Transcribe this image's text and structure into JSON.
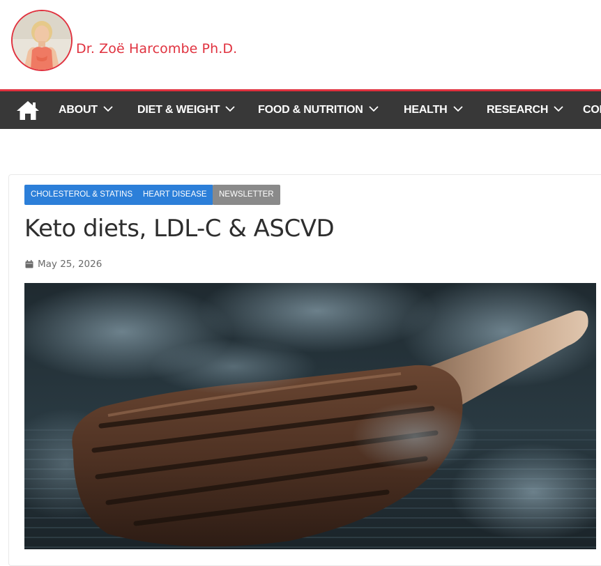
{
  "site": {
    "title": "Dr. Zoë Harcombe Ph.D."
  },
  "nav": {
    "home_icon": "home-icon",
    "items": [
      {
        "label": "ABOUT"
      },
      {
        "label": "DIET & WEIGHT"
      },
      {
        "label": "FOOD & NUTRITION"
      },
      {
        "label": "HEALTH"
      },
      {
        "label": "RESEARCH"
      },
      {
        "label": "CON"
      }
    ]
  },
  "article": {
    "categories": [
      {
        "label": "CHOLESTEROL & STATINS",
        "color": "#2c7fd9"
      },
      {
        "label": "HEART DISEASE",
        "color": "#2c7fd9"
      },
      {
        "label": "NEWSLETTER",
        "color": "#8a8a8a"
      }
    ],
    "title": "Keto diets, LDL-C & ASCVD",
    "date": "May 25, 2026",
    "date_icon": "calendar-icon",
    "image": "grilled-tomahawk-steak-photo"
  },
  "colors": {
    "accent": "#e0323f",
    "nav_bg": "#383838",
    "tag_blue": "#2c7fd9",
    "tag_grey": "#8a8a8a"
  }
}
